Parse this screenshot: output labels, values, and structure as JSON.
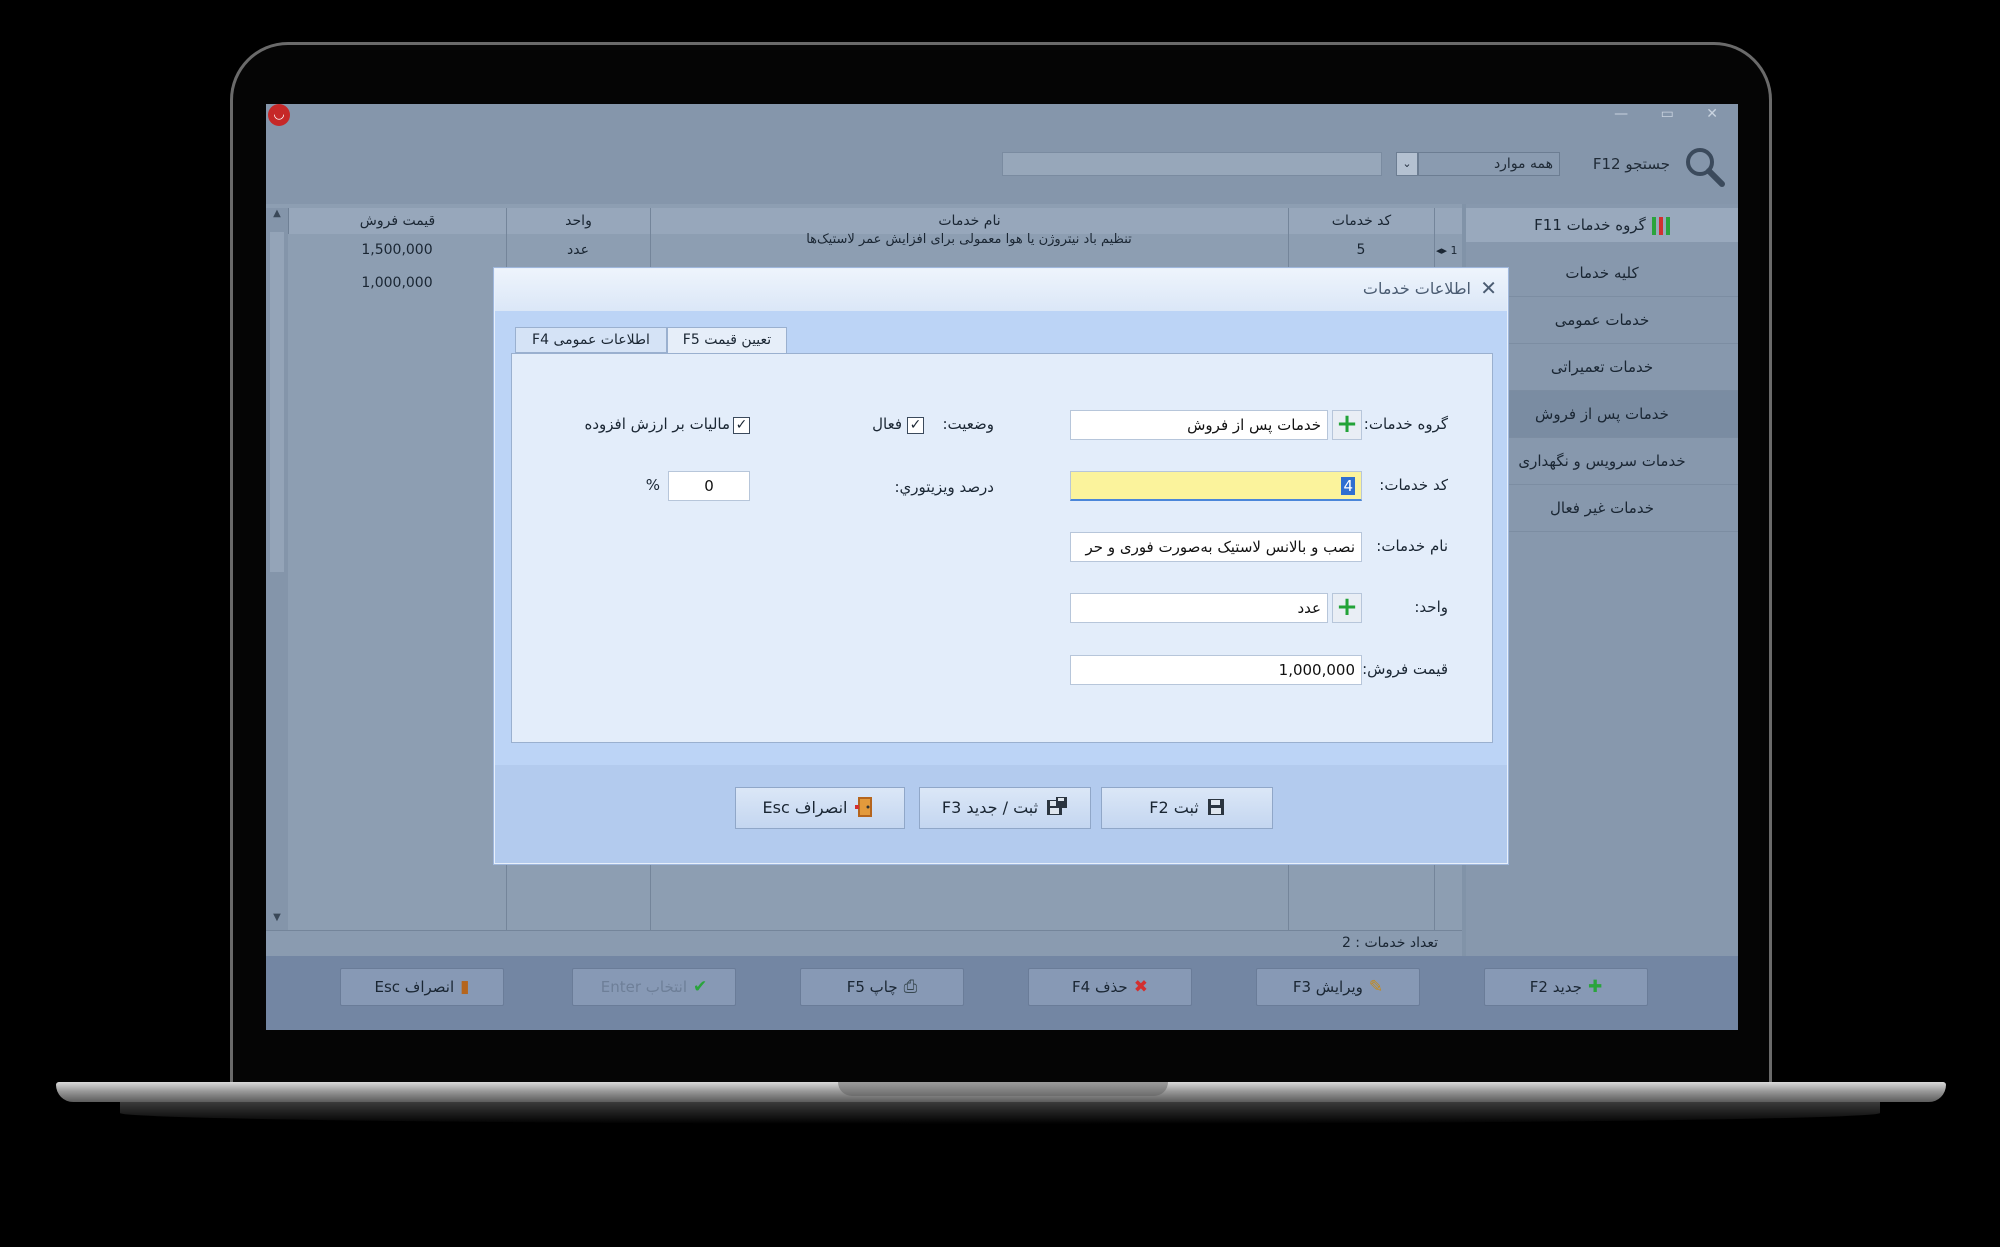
{
  "app": {
    "logo_glyph": "◡",
    "window_controls": "— ▭ ✕"
  },
  "toolbar": {
    "search_label": "جستجو F12",
    "filter_value": "همه موارد",
    "filter_arrow": "⌄",
    "search_value": ""
  },
  "sidebar": {
    "header": "گروه خدمات F11",
    "items": [
      {
        "label": "کلیه خدمات"
      },
      {
        "label": "خدمات عمومی"
      },
      {
        "label": "خدمات تعمیراتی"
      },
      {
        "label": "خدمات پس از فروش"
      },
      {
        "label": "خدمات سرویس و نگهداری"
      },
      {
        "label": "خدمات غیر فعال"
      }
    ],
    "selected_index": 3
  },
  "grid": {
    "columns": [
      "کد خدمات",
      "نام خدمات",
      "واحد",
      "قیمت فروش"
    ],
    "rows": [
      {
        "indicator": "◂▸ 1",
        "code": "5",
        "name": "تنظیم باد نیتروژن یا هوا معمولی برای افزایش عمر لاستیک‌ها",
        "unit": "عدد",
        "price": "1,500,000"
      },
      {
        "indicator": "",
        "code": "",
        "name": "",
        "unit": "",
        "price": "1,000,000"
      }
    ],
    "status": "تعداد خدمات : 2"
  },
  "bottom_buttons": [
    {
      "label": "جدید F2",
      "icon": "plus-icon",
      "glyph": "✚",
      "color": "#2aa43c",
      "enabled": true
    },
    {
      "label": "ویرایش F3",
      "icon": "pencil-icon",
      "glyph": "✎",
      "color": "#c58a1a",
      "enabled": true
    },
    {
      "label": "حذف F4",
      "icon": "delete-x-icon",
      "glyph": "✖",
      "color": "#d32f2f",
      "enabled": true
    },
    {
      "label": "چاپ F5",
      "icon": "printer-icon",
      "glyph": "⎙",
      "color": "#37474f",
      "enabled": true
    },
    {
      "label": "انتخاب Enter",
      "icon": "check-icon",
      "glyph": "✔",
      "color": "#2aa43c",
      "enabled": false
    },
    {
      "label": "انصراف Esc",
      "icon": "exit-door-icon",
      "glyph": "▮",
      "color": "#b5651d",
      "enabled": true
    }
  ],
  "dialog": {
    "title": "اطلاعات خدمات",
    "close_glyph": "✕",
    "tabs": [
      {
        "label": "اطلاعات عمومی F4",
        "active": false
      },
      {
        "label": "تعیین قیمت F5",
        "active": true
      }
    ],
    "fields": {
      "group_label": "گروه خدمات:",
      "group_value": "خدمات پس از فروش",
      "code_label": "کد خدمات:",
      "code_value": "4",
      "name_label": "نام خدمات:",
      "name_value": "نصب و بالانس لاستیک به‌صورت فوری و حر",
      "unit_label": "واحد:",
      "unit_value": "عدد",
      "price_label": "قیمت فروش:",
      "price_value": "1,000,000",
      "status_label": "وضعیت:",
      "active_label": "فعال",
      "active_checked": true,
      "vat_label": "مالیات بر ارزش افزوده",
      "vat_checked": true,
      "visitor_label": "درصد ویزیتوري:",
      "visitor_value": "0",
      "percent_sign": "%"
    },
    "buttons": [
      {
        "label": "ثبت F2",
        "icon": "save-icon",
        "glyph": "💾"
      },
      {
        "label": "ثبت / جدید F3",
        "icon": "save-new-icon",
        "glyph": "💾"
      },
      {
        "label": "انصراف Esc",
        "icon": "exit-door-icon",
        "glyph": "▮"
      }
    ]
  }
}
